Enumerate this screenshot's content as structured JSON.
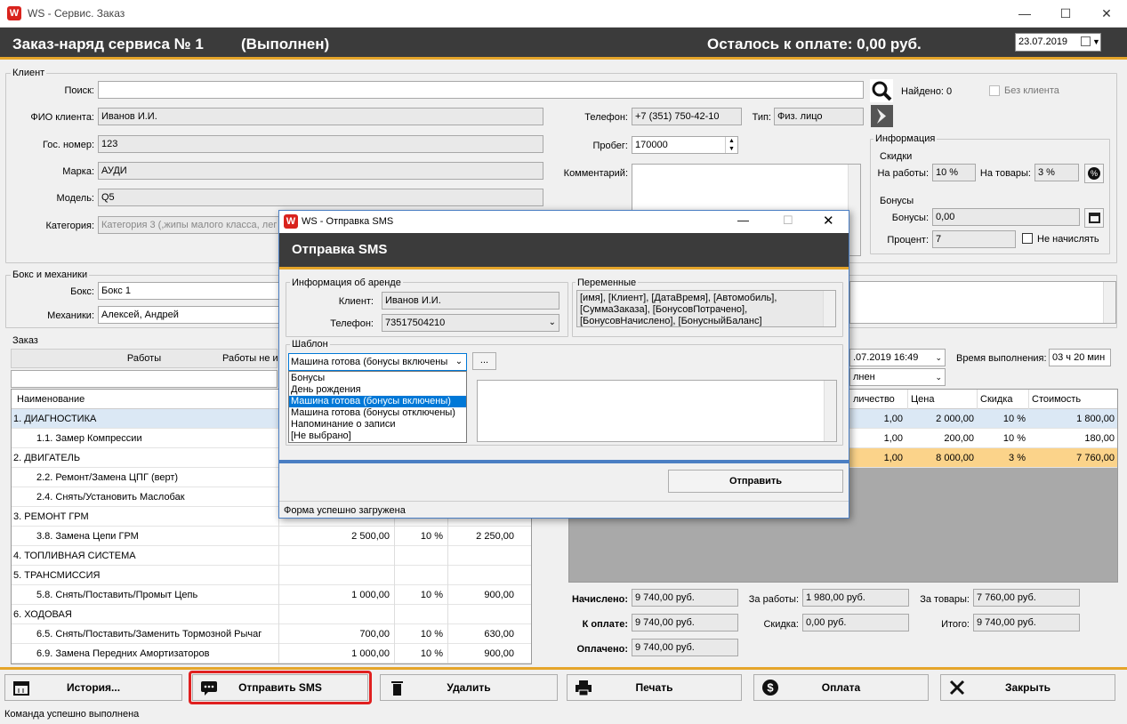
{
  "window": {
    "title": "WS - Сервис. Заказ",
    "logo": "W"
  },
  "header": {
    "title": "Заказ-наряд сервиса №  1",
    "status": "(Выполнен)",
    "remaining": "Осталось к оплате: 0,00 руб.",
    "date": "23.07.2019"
  },
  "client": {
    "group_title": "Клиент",
    "search_label": "Поиск:",
    "search_value": "",
    "found": "Найдено: 0",
    "no_client": "Без клиента",
    "name_label": "ФИО клиента:",
    "name": "Иванов И.И.",
    "plate_label": "Гос. номер:",
    "plate": "123",
    "brand_label": "Марка:",
    "brand": "АУДИ",
    "model_label": "Модель:",
    "model": "Q5",
    "category_label": "Категория:",
    "category": "Категория 3 (,жипы малого класса, лег",
    "phone_label": "Телефон:",
    "phone": "+7 (351) 750-42-10",
    "type_label": "Тип:",
    "type": "Физ. лицо",
    "mileage_label": "Пробег:",
    "mileage": "170000",
    "comment_label": "Комментарий:"
  },
  "info": {
    "group_title": "Информация",
    "discounts_title": "Скидки",
    "work_label": "На работы:",
    "work": "10 %",
    "goods_label": "На товары:",
    "goods": "3 %",
    "bonus_title": "Бонусы",
    "bonus_label": "Бонусы:",
    "bonus": "0,00",
    "percent_label": "Процент:",
    "percent": "7",
    "no_charge": "Не начислять"
  },
  "box": {
    "group_title": "Бокс и механики",
    "box_label": "Бокс:",
    "box": "Бокс 1",
    "mech_label": "Механики:",
    "mech": "Алексей, Андрей"
  },
  "order": {
    "group_title": "Заказ",
    "tab_works": "Работы",
    "tab_works2": "Работы не и",
    "col_name": "Наименование",
    "rows": [
      {
        "name": "1. ДИАГНОСТИКА",
        "indent": 0,
        "price": "",
        "disc": "",
        "sum": "",
        "sel": true
      },
      {
        "name": "1.1. Замер Компрессии",
        "indent": 1,
        "price": "",
        "disc": "",
        "sum": ""
      },
      {
        "name": "2. ДВИГАТЕЛЬ",
        "indent": 0,
        "price": "",
        "disc": "",
        "sum": ""
      },
      {
        "name": "2.2. Ремонт/Замена ЦПГ (верт)",
        "indent": 1,
        "price": "",
        "disc": "",
        "sum": ""
      },
      {
        "name": "2.4. Снять/Установить Маслобак",
        "indent": 1,
        "price": "",
        "disc": "",
        "sum": ""
      },
      {
        "name": "3. РЕМОНТ ГРМ",
        "indent": 0,
        "price": "",
        "disc": "",
        "sum": ""
      },
      {
        "name": "3.8. Замена Цепи ГРМ",
        "indent": 1,
        "price": "2 500,00",
        "disc": "10 %",
        "sum": "2 250,00"
      },
      {
        "name": "4. ТОПЛИВНАЯ СИСТЕМА",
        "indent": 0,
        "price": "",
        "disc": "",
        "sum": ""
      },
      {
        "name": "5. ТРАНСМИССИЯ",
        "indent": 0,
        "price": "",
        "disc": "",
        "sum": ""
      },
      {
        "name": "5.8. Снять/Поставить/Промыт Цепь",
        "indent": 1,
        "price": "1 000,00",
        "disc": "10 %",
        "sum": "900,00"
      },
      {
        "name": "6. ХОДОВАЯ",
        "indent": 0,
        "price": "",
        "disc": "",
        "sum": ""
      },
      {
        "name": "6.5. Снять/Поставить/Заменить Тормозной Рычаг",
        "indent": 1,
        "price": "700,00",
        "disc": "10 %",
        "sum": "630,00"
      },
      {
        "name": "6.9. Замена Передних Амортизаторов",
        "indent": 1,
        "price": "1 000,00",
        "disc": "10 %",
        "sum": "900,00"
      }
    ],
    "date_value": ".07.2019 16:49",
    "exec_label": "Время выполнения:",
    "exec_value": "03 ч 20 мин",
    "status_value": "лнен",
    "goods_cols": [
      "личество",
      "Цена",
      "Скидка",
      "Стоимость"
    ],
    "goods_rows": [
      {
        "qty": "1,00",
        "price": "2 000,00",
        "disc": "10 %",
        "sum": "1 800,00"
      },
      {
        "qty": "1,00",
        "price": "200,00",
        "disc": "10 %",
        "sum": "180,00"
      },
      {
        "qty": "1,00",
        "price": "8 000,00",
        "disc": "3 %",
        "sum": "7 760,00"
      }
    ]
  },
  "totals": {
    "charged_label": "Начислено:",
    "charged": "9 740,00 руб.",
    "topay_label": "К оплате:",
    "topay": "9 740,00 руб.",
    "paid_label": "Оплачено:",
    "paid": "9 740,00 руб.",
    "for_work_label": "За работы:",
    "for_work": "1 980,00 руб.",
    "discount_label": "Скидка:",
    "discount": "0,00 руб.",
    "for_goods_label": "За товары:",
    "for_goods": "7 760,00 руб.",
    "total_label": "Итого:",
    "total": "9 740,00 руб."
  },
  "dialog": {
    "title": "WS - Отправка SMS",
    "header": "Отправка SMS",
    "info_title": "Информация об аренде",
    "client_label": "Клиент:",
    "client": "Иванов И.И.",
    "phone_label": "Телефон:",
    "phone": "73517504210",
    "vars_title": "Переменные",
    "vars": "[имя], [Клиент], [ДатаВремя], [Автомобиль], [СуммаЗаказа], [БонусовПотрачено], [БонусовНачислено], [БонусныйБаланс]",
    "template_title": "Шаблон",
    "template_selected": "Машина готова (бонусы включены",
    "dots": "...",
    "options": [
      "Бонусы",
      "День рождения",
      "Машина готова (бонусы включены)",
      "Машина готова (бонусы отключены)",
      "Напоминание о записи",
      "[Не выбрано]"
    ],
    "send": "Отправить",
    "status": "Форма успешно загружена"
  },
  "buttons": {
    "history": "История...",
    "sms": "Отправить SMS",
    "delete": "Удалить",
    "print": "Печать",
    "pay": "Оплата",
    "close": "Закрыть"
  },
  "statusbar": "Команда успешно выполнена",
  "colors": {
    "header": "#3b3b3b",
    "accent": "#e5a52a",
    "selected_row": "#dbe8f5",
    "highlight_row": "#fbd38a",
    "select_blue": "#0078d7",
    "sms_outline": "#e02020"
  }
}
